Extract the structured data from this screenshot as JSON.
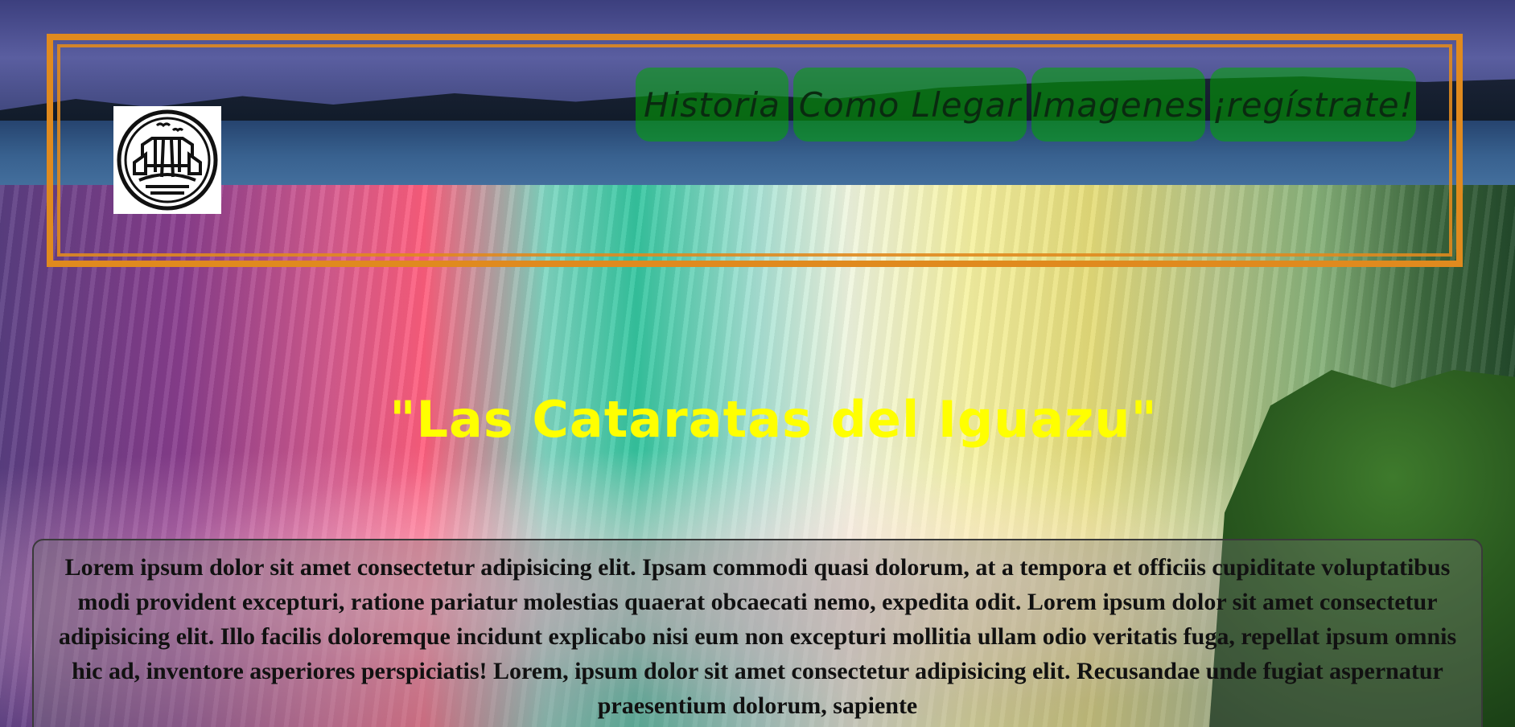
{
  "header": {
    "logo_icon": "waterfall-emblem-icon",
    "nav": [
      {
        "label": "Historia"
      },
      {
        "label": "Como Llegar"
      },
      {
        "label": "Imagenes"
      },
      {
        "label": "¡regístrate!"
      }
    ]
  },
  "hero": {
    "title": "\"Las Cataratas del Iguazu\""
  },
  "content": {
    "paragraph": "Lorem ipsum dolor sit amet consectetur adipisicing elit. Ipsam commodi quasi dolorum, at a tempora et officiis cupiditate voluptatibus modi provident excepturi, ratione pariatur molestias quaerat obcaecati nemo, expedita odit. Lorem ipsum dolor sit amet consectetur adipisicing elit. Illo facilis doloremque incidunt explicabo nisi eum non excepturi mollitia ullam odio veritatis fuga, repellat ipsum omnis hic ad, inventore asperiores perspiciatis! Lorem, ipsum dolor sit amet consectetur adipisicing elit. Recusandae unde fugiat aspernatur praesentium dolorum, sapiente"
  },
  "colors": {
    "frame": "#e08a1e",
    "nav_bg": "#00aa00",
    "title": "#ffff00"
  }
}
